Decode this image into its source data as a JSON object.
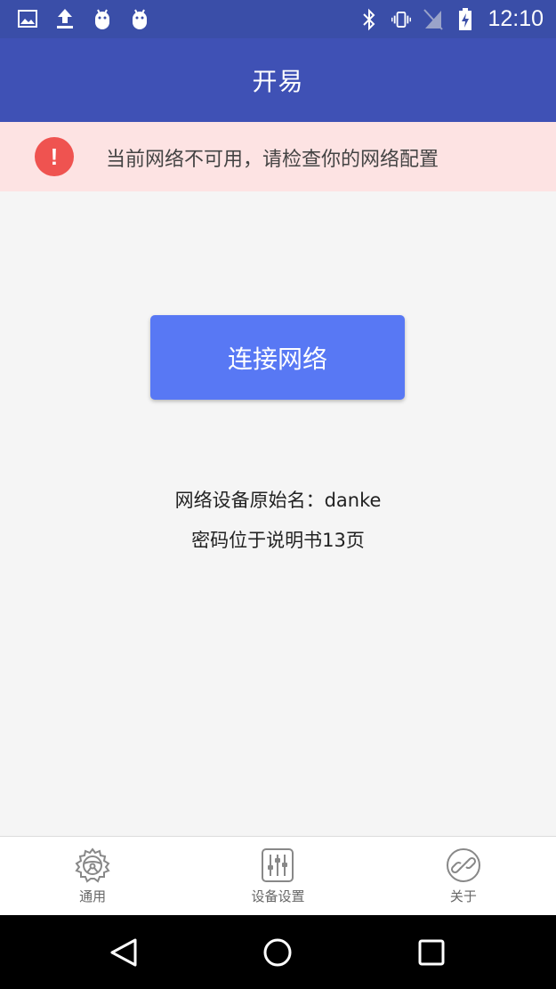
{
  "status_bar": {
    "time": "12:10",
    "left_icons": [
      "image-icon",
      "upload-icon",
      "android-icon",
      "android-icon"
    ],
    "right_icons": [
      "bluetooth-icon",
      "vibrate-icon",
      "no-sim-icon",
      "battery-charging-icon"
    ]
  },
  "app_bar": {
    "title": "开易"
  },
  "alert": {
    "icon": "exclamation-icon",
    "icon_glyph": "!",
    "message": "当前网络不可用，请检查你的网络配置",
    "background": "#fde3e3",
    "icon_color": "#ef5350"
  },
  "main": {
    "connect_button_label": "连接网络",
    "device_name_line": "网络设备原始名：danke",
    "password_hint_line": "密码位于说明书13页"
  },
  "bottom_nav": {
    "items": [
      {
        "label": "通用",
        "icon": "steering-wheel-gear-icon"
      },
      {
        "label": "设备设置",
        "icon": "sliders-icon"
      },
      {
        "label": "关于",
        "icon": "link-icon"
      }
    ]
  },
  "system_nav": {
    "buttons": [
      "back-icon",
      "home-icon",
      "recents-icon"
    ]
  },
  "colors": {
    "status_bar": "#3a4ea8",
    "app_bar": "#3f51b5",
    "button": "#5878f4",
    "background": "#f5f5f5"
  }
}
